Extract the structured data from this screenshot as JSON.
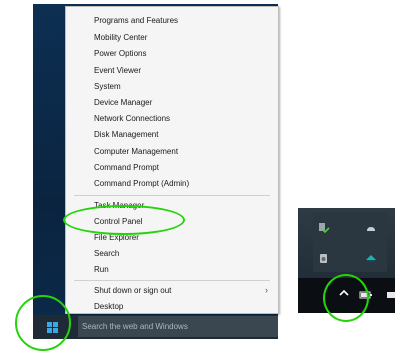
{
  "menu": {
    "items": [
      {
        "label": "Programs and Features"
      },
      {
        "label": "Mobility Center"
      },
      {
        "label": "Power Options"
      },
      {
        "label": "Event Viewer"
      },
      {
        "label": "System"
      },
      {
        "label": "Device Manager"
      },
      {
        "label": "Network Connections"
      },
      {
        "label": "Disk Management"
      },
      {
        "label": "Computer Management"
      },
      {
        "label": "Command Prompt"
      },
      {
        "label": "Command Prompt (Admin)"
      },
      {
        "label": "Task Manager"
      },
      {
        "label": "Control Panel"
      },
      {
        "label": "File Explorer"
      },
      {
        "label": "Search"
      },
      {
        "label": "Run"
      },
      {
        "label": "Shut down or sign out"
      },
      {
        "label": "Desktop"
      }
    ],
    "submenu_arrow": "›"
  },
  "taskbar": {
    "search_placeholder": "Search the web and Windows"
  },
  "colors": {
    "highlight": "#24d40a",
    "desktop": "#0d2f52",
    "start_logo": "#3aa7e6"
  },
  "tray": {
    "chevron": "^"
  }
}
